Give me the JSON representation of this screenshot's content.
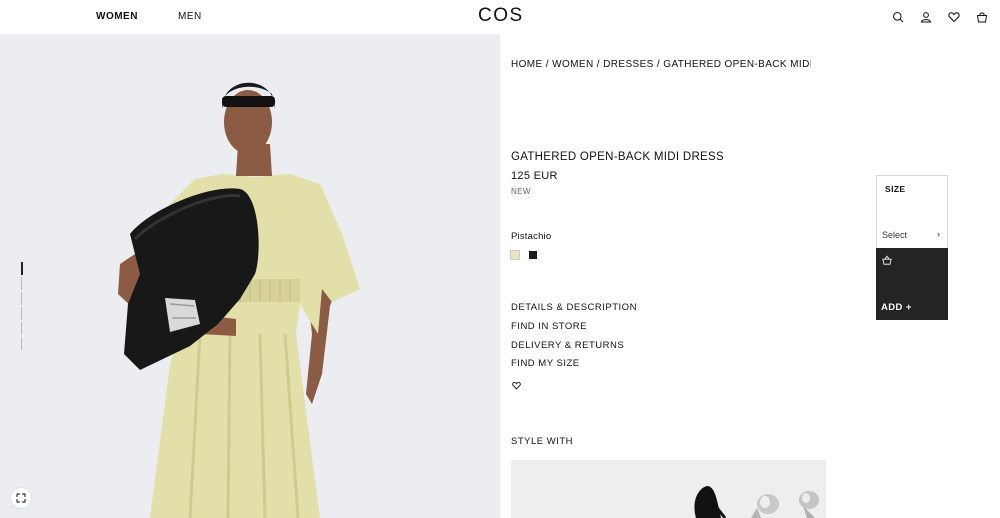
{
  "header": {
    "nav_women": "WOMEN",
    "nav_men": "MEN",
    "logo": "COS",
    "icons": [
      "search-icon",
      "account-icon",
      "wishlist-icon",
      "bag-icon"
    ]
  },
  "breadcrumb": {
    "home": "HOME",
    "women": "WOMEN",
    "dresses": "DRESSES",
    "current": "GATHERED OPEN-BACK MIDI DRESS",
    "separator": " / "
  },
  "product": {
    "title": "GATHERED OPEN-BACK MIDI DRESS",
    "price": "125 EUR",
    "badge": "NEW",
    "color_name": "Pistachio",
    "swatches": [
      {
        "name": "Pistachio",
        "color": "#e6e3c7",
        "selected": true
      },
      {
        "name": "Black",
        "color": "#1a1a1a",
        "selected": false
      }
    ]
  },
  "links": {
    "details": "DETAILS & DESCRIPTION",
    "find_store": "FIND IN STORE",
    "delivery": "DELIVERY & RETURNS",
    "find_size": "FIND MY SIZE"
  },
  "style_with": "STYLE WITH",
  "size_panel": {
    "label": "SIZE",
    "select_value": "Select",
    "chevron": "›",
    "add_label": "ADD  +"
  },
  "gallery": {
    "image_count": 6,
    "active_index": 0
  },
  "colors": {
    "image_bg": "#ebedf0",
    "dress": "#e3dfa8",
    "add_button": "#242424"
  }
}
